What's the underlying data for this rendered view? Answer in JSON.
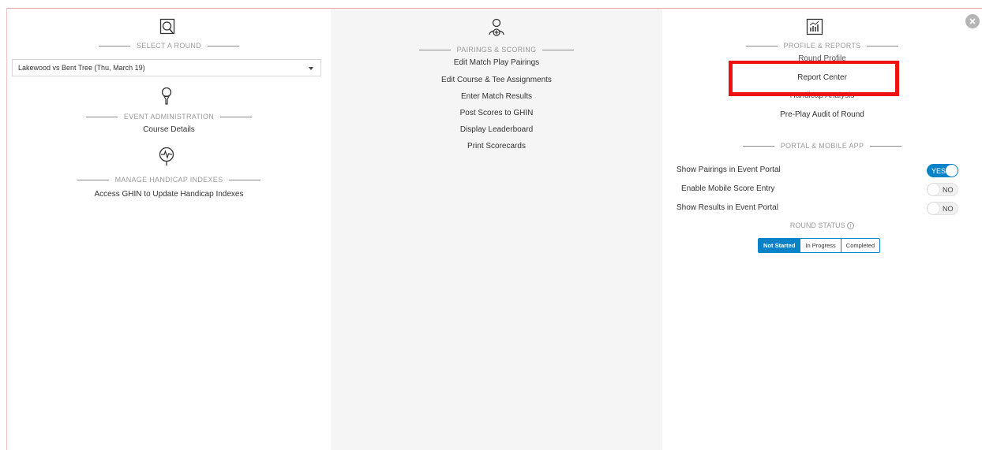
{
  "left": {
    "select_round_title": "SELECT A ROUND",
    "select_value": "Lakewood vs Bent Tree (Thu, March 19)",
    "event_admin_title": "EVENT ADMINISTRATION",
    "course_details": "Course Details",
    "handicap_title": "MANAGE HANDICAP INDEXES",
    "access_ghin": "Access GHIN to Update Handicap Indexes"
  },
  "middle": {
    "title": "PAIRINGS & SCORING",
    "links": [
      "Edit Match Play Pairings",
      "Edit Course & Tee Assignments",
      "Enter Match Results",
      "Post Scores to GHIN",
      "Display Leaderboard",
      "Print Scorecards"
    ]
  },
  "right": {
    "profile_title": "PROFILE & REPORTS",
    "links": [
      "Round Profile",
      "Report Center",
      "Handicap Analysis",
      "Pre-Play Audit of Round"
    ],
    "portal_title": "PORTAL & MOBILE APP",
    "toggles": [
      {
        "label": "Show Pairings in Event Portal",
        "value": "YES",
        "on": true
      },
      {
        "label": "Enable Mobile Score Entry",
        "value": "NO",
        "on": false
      },
      {
        "label": "Show Results in Event Portal",
        "value": "NO",
        "on": false
      }
    ],
    "round_status_title": "ROUND STATUS",
    "status_options": [
      "Not Started",
      "In Progress",
      "Completed"
    ],
    "status_selected": "Not Started"
  },
  "icons": {
    "select_round": "search-document-icon",
    "event_admin": "golf-tee-icon",
    "handicap": "heartbeat-pin-icon",
    "pairings": "add-user-icon",
    "reports": "report-chart-icon",
    "info": "info-icon",
    "close": "close-icon"
  },
  "colors": {
    "accent": "#0a82c8",
    "highlight": "#ee1111",
    "mid_panel_bg": "#f5f5f5"
  }
}
